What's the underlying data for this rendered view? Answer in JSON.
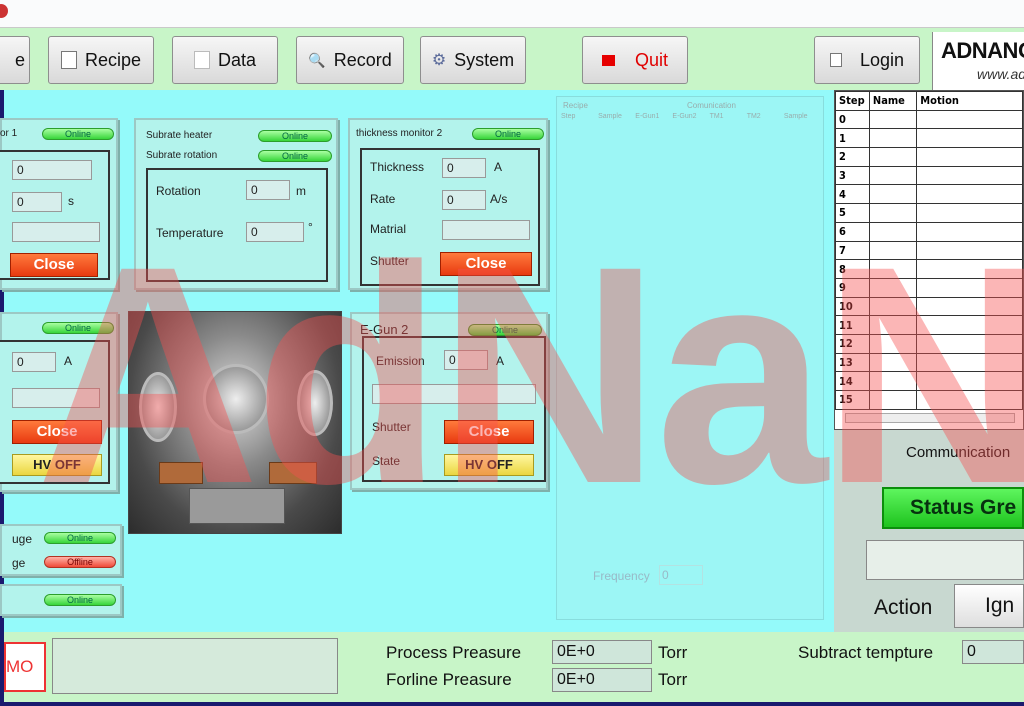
{
  "toolbar": {
    "e_partial": "e",
    "recipe": "Recipe",
    "data": "Data",
    "record": "Record",
    "system": "System",
    "quit": "Quit",
    "login": "Login"
  },
  "logo": {
    "name": "ADNANOT",
    "url": "www.ad"
  },
  "monitor1": {
    "title": "or 1",
    "status": "Online",
    "value1": "0",
    "value2": "0",
    "unit2": "s",
    "close": "Close"
  },
  "heater": {
    "label_heater": "Subrate heater",
    "status_heater": "Online",
    "label_rotation": "Subrate rotation",
    "status_rotation": "Online",
    "rotation_label": "Rotation",
    "rotation_value": "0",
    "rotation_unit": "m",
    "temp_label": "Temperature",
    "temp_value": "0",
    "temp_unit": "°"
  },
  "monitor2": {
    "title": "thickness monitor 2",
    "status": "Online",
    "thickness_label": "Thickness",
    "thickness_value": "0",
    "thickness_unit": "A",
    "rate_label": "Rate",
    "rate_value": "0",
    "rate_unit": "A/s",
    "material_label": "Matrial",
    "material_value": "",
    "shutter_label": "Shutter",
    "close": "Close"
  },
  "egun1": {
    "status": "Online",
    "value": "0",
    "unit": "A",
    "close": "Close",
    "hv": "HV OFF"
  },
  "egun2": {
    "title": "E-Gun 2",
    "status": "Online",
    "emission_label": "Emission",
    "emission_value": "0",
    "emission_unit": "A",
    "shutter_label": "Shutter",
    "close": "Close",
    "state_label": "State",
    "hv": "HV OFF"
  },
  "gauges": {
    "row1_label": "uge",
    "row1_status": "Online",
    "row2_label": "ge",
    "row2_status": "Offline",
    "row3_status": "Online"
  },
  "ghost": {
    "header_left": "Recipe",
    "header_right": "Comunication",
    "tabs": [
      "Step",
      "Sample",
      "E-Gun1",
      "E-Gun2",
      "TM1",
      "TM2",
      "Sample"
    ],
    "frequency_label": "Frequency",
    "frequency_value": "0"
  },
  "steps": {
    "headers": [
      "Step",
      "Name",
      "Motion"
    ],
    "rows": [
      "0",
      "1",
      "2",
      "3",
      "4",
      "5",
      "6",
      "7",
      "8",
      "9",
      "10",
      "11",
      "12",
      "13",
      "14",
      "15"
    ]
  },
  "right": {
    "communication": "Communication",
    "status": "Status Gre",
    "action": "Action",
    "ignore": "Ign"
  },
  "bottom": {
    "mo": "MO",
    "process_label": "Process Preasure",
    "process_value": "0E+0",
    "process_unit": "Torr",
    "forline_label": "Forline Preasure",
    "forline_value": "0E+0",
    "forline_unit": "Torr",
    "subtract_label": "Subtract tempture",
    "subtract_value": "0"
  },
  "watermark": "AdNaNo",
  "colors": {
    "online": "#37d53a",
    "offline": "#f04a38",
    "close": "#e83a10",
    "hv": "#ead640",
    "status": "#1ec31e"
  }
}
